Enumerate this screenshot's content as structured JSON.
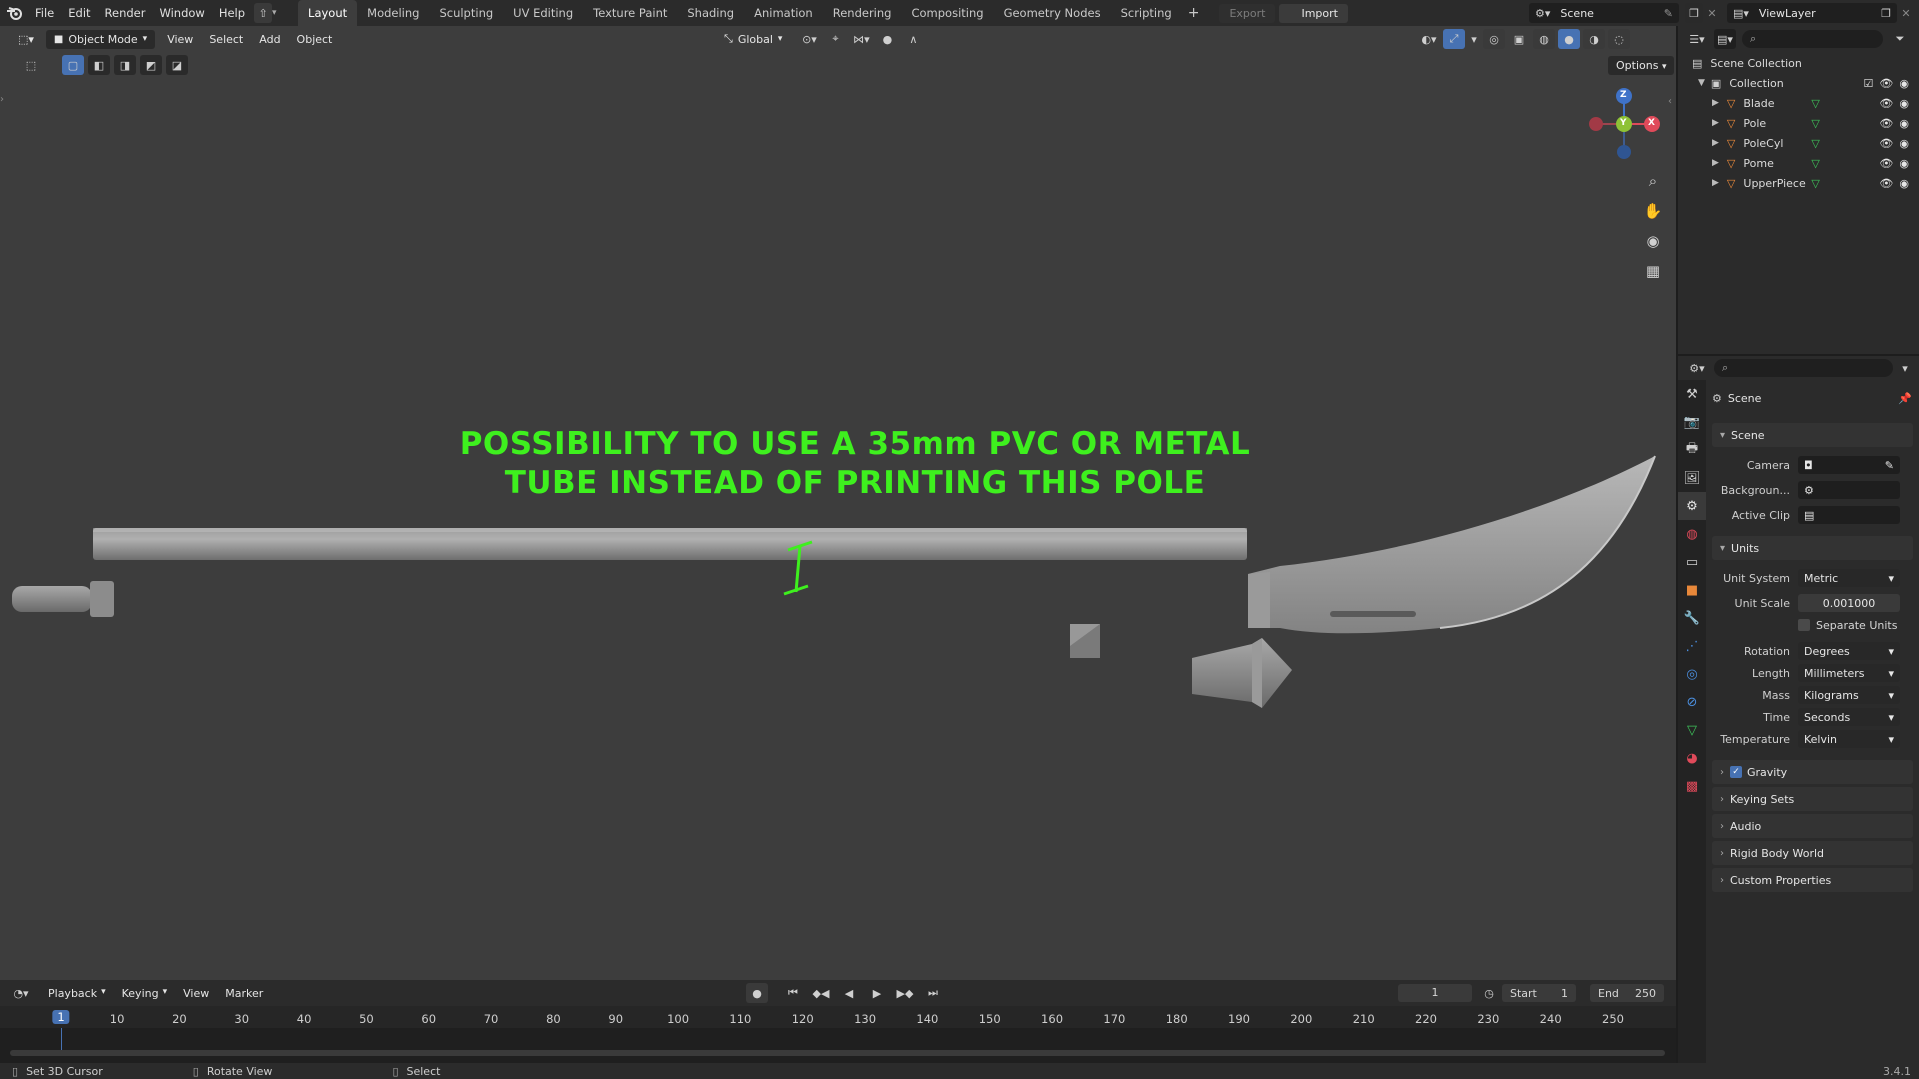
{
  "topbar": {
    "menus": [
      "File",
      "Edit",
      "Render",
      "Window",
      "Help"
    ],
    "workspaces": [
      "Layout",
      "Modeling",
      "Sculpting",
      "UV Editing",
      "Texture Paint",
      "Shading",
      "Animation",
      "Rendering",
      "Compositing",
      "Geometry Nodes",
      "Scripting"
    ],
    "active_workspace": "Layout",
    "add_workspace": "+",
    "export_label": "Export",
    "import_label": "Import",
    "scene_name": "Scene",
    "view_layer": "ViewLayer"
  },
  "viewport": {
    "mode": "Object Mode",
    "menus": [
      "View",
      "Select",
      "Add",
      "Object"
    ],
    "transform_orientation": "Global",
    "options_label": "Options",
    "gizmo": {
      "x": "X",
      "y": "Y",
      "z": "Z"
    },
    "annotation_line1": "POSSIBILITY TO USE A 35mm PVC OR METAL",
    "annotation_line2": "TUBE INSTEAD OF PRINTING THIS POLE"
  },
  "outliner": {
    "root": "Scene Collection",
    "collection": "Collection",
    "objects": [
      "Blade",
      "Pole",
      "PoleCyl",
      "Pome",
      "UpperPiece"
    ]
  },
  "properties": {
    "context": "Scene",
    "panel_scene": "Scene",
    "camera_label": "Camera",
    "background_label": "Backgroun...",
    "active_clip_label": "Active Clip",
    "panel_units": "Units",
    "unit_system_label": "Unit System",
    "unit_system_value": "Metric",
    "unit_scale_label": "Unit Scale",
    "unit_scale_value": "0.001000",
    "separate_units_label": "Separate Units",
    "rotation_label": "Rotation",
    "rotation_value": "Degrees",
    "length_label": "Length",
    "length_value": "Millimeters",
    "mass_label": "Mass",
    "mass_value": "Kilograms",
    "time_label": "Time",
    "time_value": "Seconds",
    "temperature_label": "Temperature",
    "temperature_value": "Kelvin",
    "gravity_label": "Gravity",
    "keying_sets_label": "Keying Sets",
    "audio_label": "Audio",
    "rigid_body_label": "Rigid Body World",
    "custom_props_label": "Custom Properties"
  },
  "timeline": {
    "menus": [
      "Playback",
      "Keying",
      "View",
      "Marker"
    ],
    "current_frame": "1",
    "start_label": "Start",
    "start_value": "1",
    "end_label": "End",
    "end_value": "250",
    "ruler": [
      "1",
      "10",
      "20",
      "30",
      "40",
      "50",
      "60",
      "70",
      "80",
      "90",
      "100",
      "110",
      "120",
      "130",
      "140",
      "150",
      "160",
      "170",
      "180",
      "190",
      "200",
      "210",
      "220",
      "230",
      "240",
      "250"
    ]
  },
  "statusbar": {
    "hint1": "Set 3D Cursor",
    "hint2": "Rotate View",
    "hint3": "Select",
    "version": "3.4.1"
  },
  "colors": {
    "annotation": "#3ef01e",
    "accent": "#4772b3",
    "object_orange": "#e8883a"
  }
}
